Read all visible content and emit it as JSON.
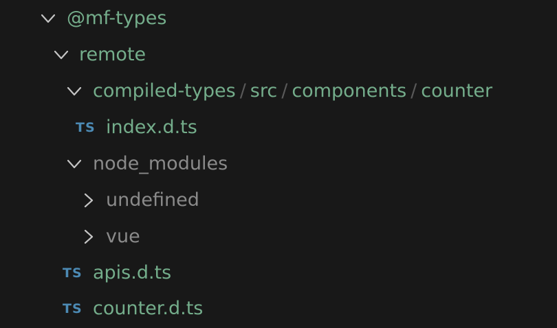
{
  "explorer": {
    "items": [
      {
        "label": "@mf-types",
        "kind": "folder",
        "expanded": true
      },
      {
        "label": "remote",
        "kind": "folder",
        "expanded": true
      },
      {
        "path": [
          "compiled-types",
          "src",
          "components",
          "counter"
        ],
        "separator": "/",
        "kind": "folder",
        "expanded": true
      },
      {
        "icon_text": "TS",
        "label": "index.d.ts",
        "kind": "file"
      },
      {
        "label": "node_modules",
        "kind": "folder",
        "expanded": true
      },
      {
        "label": "undefined",
        "kind": "folder",
        "expanded": false
      },
      {
        "label": "vue",
        "kind": "folder",
        "expanded": false
      },
      {
        "icon_text": "TS",
        "label": "apis.d.ts",
        "kind": "file"
      },
      {
        "icon_text": "TS",
        "label": "counter.d.ts",
        "kind": "file"
      }
    ]
  },
  "colors": {
    "background": "#181818",
    "tracked_text": "#74ad8b",
    "ignored_text": "#8a8a8a",
    "ts_icon": "#4c8ab4",
    "chevron": "#c5c5c5"
  }
}
